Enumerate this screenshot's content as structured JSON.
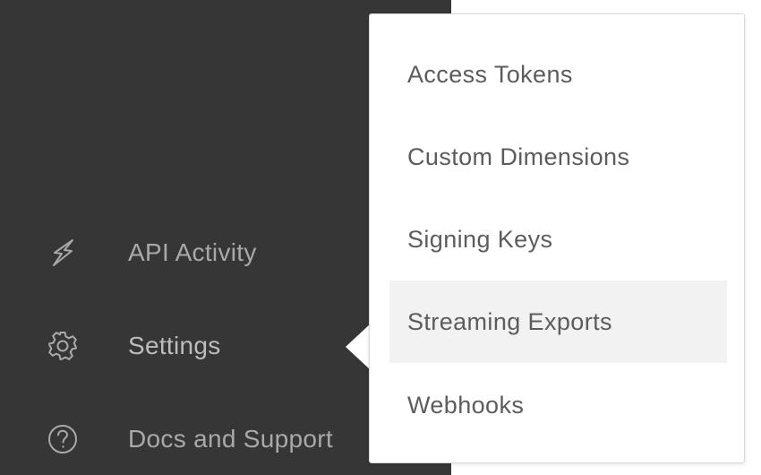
{
  "sidebar": {
    "items": [
      {
        "label": "API Activity",
        "icon": "lightning-bolt-icon"
      },
      {
        "label": "Settings",
        "icon": "gear-icon"
      },
      {
        "label": "Docs and Support",
        "icon": "question-circle-icon"
      }
    ]
  },
  "settings_menu": {
    "items": [
      {
        "label": "Access Tokens"
      },
      {
        "label": "Custom Dimensions"
      },
      {
        "label": "Signing Keys"
      },
      {
        "label": "Streaming Exports",
        "highlighted": true
      },
      {
        "label": "Webhooks"
      }
    ]
  },
  "colors": {
    "sidebar_bg": "#363636",
    "nav_text": "#a9a9a9",
    "menu_text": "#5c5c5c",
    "menu_hover_bg": "#f2f2f2"
  }
}
